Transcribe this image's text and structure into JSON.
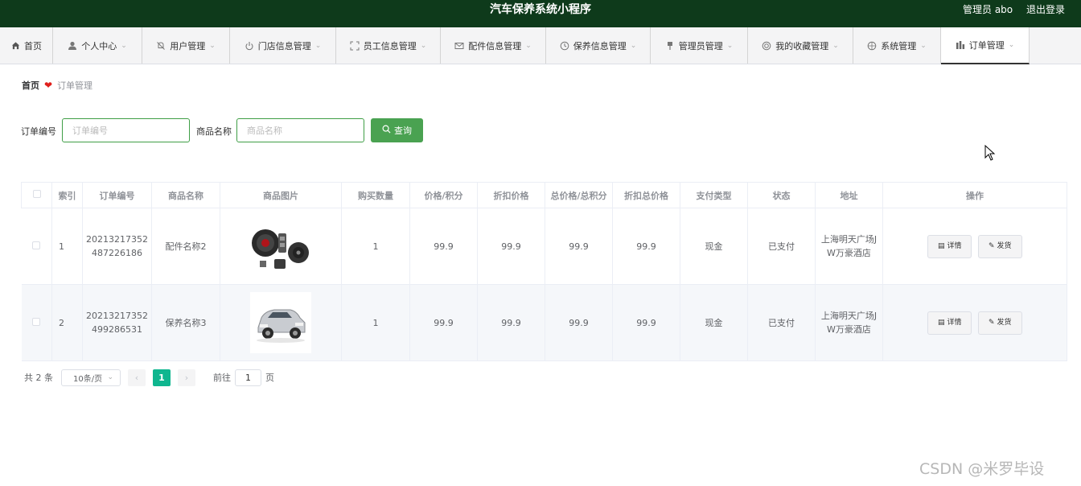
{
  "header": {
    "title": "汽车保养系统小程序",
    "admin_label": "管理员 abo",
    "logout_label": "退出登录"
  },
  "nav": {
    "items": [
      {
        "label": "首页",
        "icon": "home-icon"
      },
      {
        "label": "个人中心",
        "icon": "user-icon"
      },
      {
        "label": "用户管理",
        "icon": "bell-off-icon"
      },
      {
        "label": "门店信息管理",
        "icon": "power-icon"
      },
      {
        "label": "员工信息管理",
        "icon": "fullscreen-icon"
      },
      {
        "label": "配件信息管理",
        "icon": "message-icon"
      },
      {
        "label": "保养信息管理",
        "icon": "clock-icon"
      },
      {
        "label": "管理员管理",
        "icon": "pin-icon"
      },
      {
        "label": "我的收藏管理",
        "icon": "star-circle-icon"
      },
      {
        "label": "系统管理",
        "icon": "compass-icon"
      },
      {
        "label": "订单管理",
        "icon": "chart-icon",
        "active": true
      }
    ]
  },
  "breadcrumb": {
    "home": "首页",
    "current": "订单管理"
  },
  "search": {
    "order_no_label": "订单编号",
    "order_no_placeholder": "订单编号",
    "product_name_label": "商品名称",
    "product_name_placeholder": "商品名称",
    "query_button": "查询"
  },
  "table": {
    "columns": [
      "索引",
      "订单编号",
      "商品名称",
      "商品图片",
      "购买数量",
      "价格/积分",
      "折扣价格",
      "总价格/总积分",
      "折扣总价格",
      "支付类型",
      "状态",
      "地址",
      "操作"
    ],
    "rows": [
      {
        "index": "1",
        "order_no_line1": "20213217352",
        "order_no_line2": "487226186",
        "product_name": "配件名称2",
        "image": "speaker-parts-image",
        "quantity": "1",
        "price": "99.9",
        "discount_price": "99.9",
        "total_price": "99.9",
        "discount_total": "99.9",
        "pay_type": "现金",
        "status": "已支付",
        "address_line1": "上海明天广场J",
        "address_line2": "W万豪酒店"
      },
      {
        "index": "2",
        "order_no_line1": "20213217352",
        "order_no_line2": "499286531",
        "product_name": "保养名称3",
        "image": "suv-car-image",
        "quantity": "1",
        "price": "99.9",
        "discount_price": "99.9",
        "total_price": "99.9",
        "discount_total": "99.9",
        "pay_type": "现金",
        "status": "已支付",
        "address_line1": "上海明天广场J",
        "address_line2": "W万豪酒店"
      }
    ],
    "detail_button": "详情",
    "ship_button": "发货"
  },
  "pagination": {
    "total": "共 2 条",
    "page_size": "10条/页",
    "current_page": "1",
    "goto_label": "前往",
    "goto_value": "1",
    "page_unit": "页"
  },
  "watermark": "CSDN @米罗毕设",
  "colors": {
    "header_bg": "#0e3a1b",
    "accent_green": "#4aa251",
    "page_active": "#0fb68f",
    "heart": "#e0201c"
  }
}
